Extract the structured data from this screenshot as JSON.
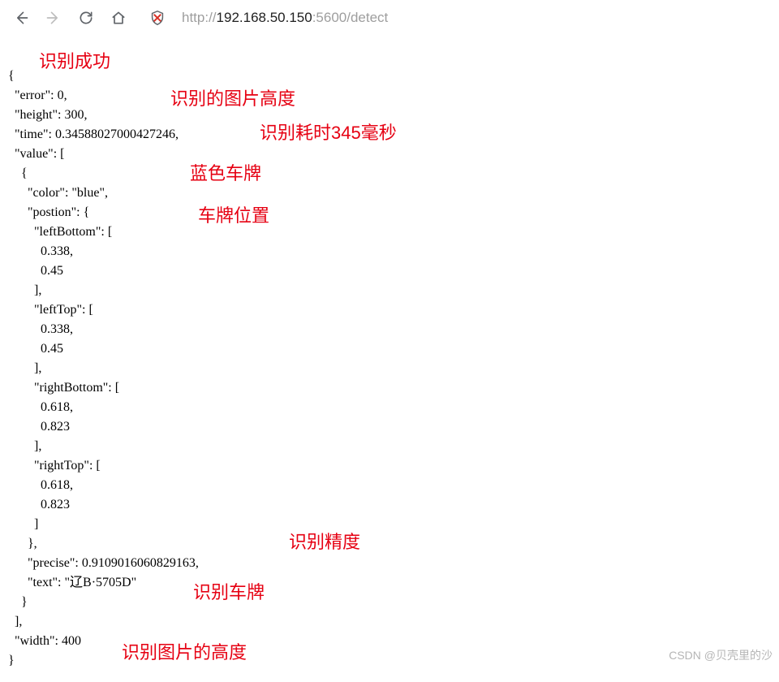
{
  "toolbar": {
    "url_prefix": "http://",
    "url_host": "192.168.50.150",
    "url_suffix": ":5600/detect"
  },
  "json": {
    "open_brace": "{",
    "error_line": "  \"error\": 0,",
    "height_line": "  \"height\": 300,",
    "time_line": "  \"time\": 0.34588027000427246,",
    "value_open": "  \"value\": [",
    "value_item_open": "    {",
    "color_line": "      \"color\": \"blue\",",
    "postion_open": "      \"postion\": {",
    "lb_open": "        \"leftBottom\": [",
    "lb_v1": "          0.338,",
    "lb_v2": "          0.45",
    "lb_close": "        ],",
    "lt_open": "        \"leftTop\": [",
    "lt_v1": "          0.338,",
    "lt_v2": "          0.45",
    "lt_close": "        ],",
    "rb_open": "        \"rightBottom\": [",
    "rb_v1": "          0.618,",
    "rb_v2": "          0.823",
    "rb_close": "        ],",
    "rt_open": "        \"rightTop\": [",
    "rt_v1": "          0.618,",
    "rt_v2": "          0.823",
    "rt_close": "        ]",
    "postion_close": "      },",
    "precise_line": "      \"precise\": 0.9109016060829163,",
    "text_line": "      \"text\": \"辽B·5705D\"",
    "value_item_close": "    }",
    "value_close": "  ],",
    "width_line": "  \"width\": 400",
    "close_brace": "}"
  },
  "annotations": {
    "success": "识别成功",
    "img_height": "识别的图片高度",
    "time_ms": "识别耗时345毫秒",
    "blue_plate": "蓝色车牌",
    "plate_pos": "车牌位置",
    "precision": "识别精度",
    "plate_text": "识别车牌",
    "img_width": "识别图片的高度"
  },
  "watermark": "CSDN @贝壳里的沙"
}
